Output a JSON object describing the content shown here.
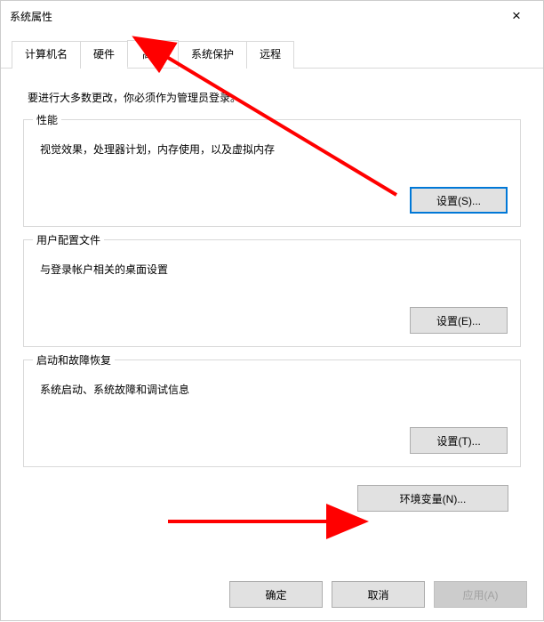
{
  "dialog": {
    "title": "系统属性",
    "close_label": "×"
  },
  "tabs": {
    "items": [
      {
        "label": "计算机名"
      },
      {
        "label": "硬件"
      },
      {
        "label": "高级"
      },
      {
        "label": "系统保护"
      },
      {
        "label": "远程"
      }
    ]
  },
  "content": {
    "intro": "要进行大多数更改，你必须作为管理员登录。"
  },
  "performance": {
    "title": "性能",
    "desc": "视觉效果，处理器计划，内存使用，以及虚拟内存",
    "button": "设置(S)..."
  },
  "profiles": {
    "title": "用户配置文件",
    "desc": "与登录帐户相关的桌面设置",
    "button": "设置(E)..."
  },
  "startup": {
    "title": "启动和故障恢复",
    "desc": "系统启动、系统故障和调试信息",
    "button": "设置(T)..."
  },
  "env_var": {
    "button": "环境变量(N)..."
  },
  "footer": {
    "ok": "确定",
    "cancel": "取消",
    "apply": "应用(A)"
  }
}
